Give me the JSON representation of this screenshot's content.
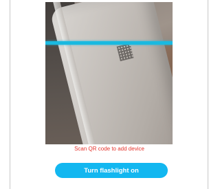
{
  "scanner": {
    "hint": "Scan QR code to add device",
    "flashlight_button": "Turn flashlight on",
    "scan_line_color": "#1ab9e0",
    "hint_color": "#e5322b",
    "button_color": "#12b7f0"
  }
}
